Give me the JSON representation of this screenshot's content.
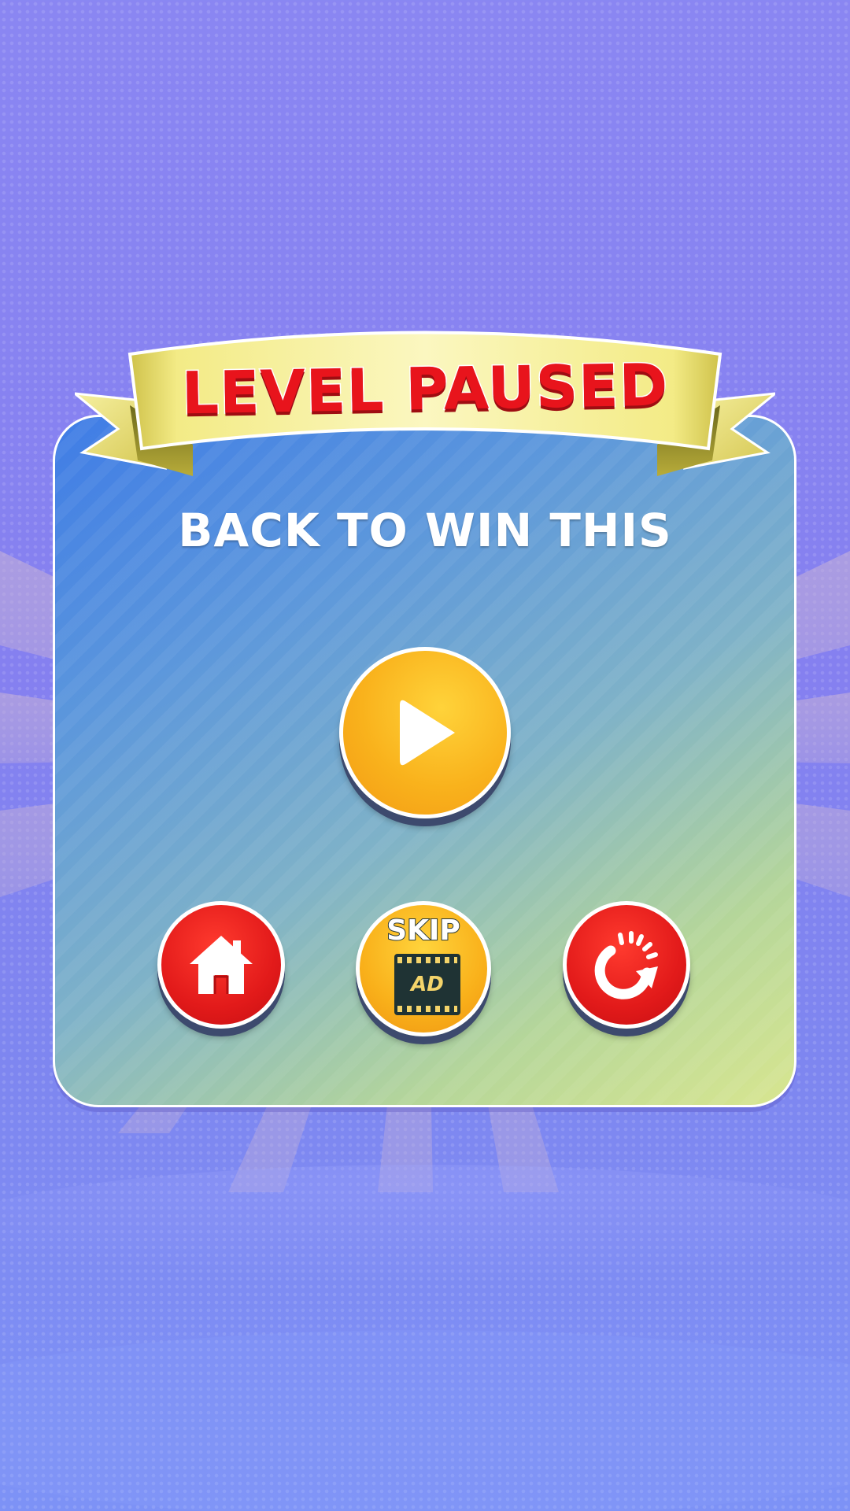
{
  "dialog": {
    "title": "LEVEL PAUSED",
    "subtitle": "BACK TO WIN THIS"
  },
  "buttons": {
    "play_icon": "play-icon",
    "home_icon": "home-icon",
    "restart_icon": "restart-icon",
    "skip": {
      "top_label": "SKIP",
      "ad_label": "AD",
      "icon": "film-strip-icon"
    }
  },
  "colors": {
    "background": "#8a86f2",
    "title_text": "#e8141c",
    "ribbon_gold": "#e8e27a",
    "primary_button": "#f9b21c",
    "secondary_button": "#e21a1a",
    "panel_start": "#3f7ce6",
    "panel_end": "#d8e690"
  }
}
